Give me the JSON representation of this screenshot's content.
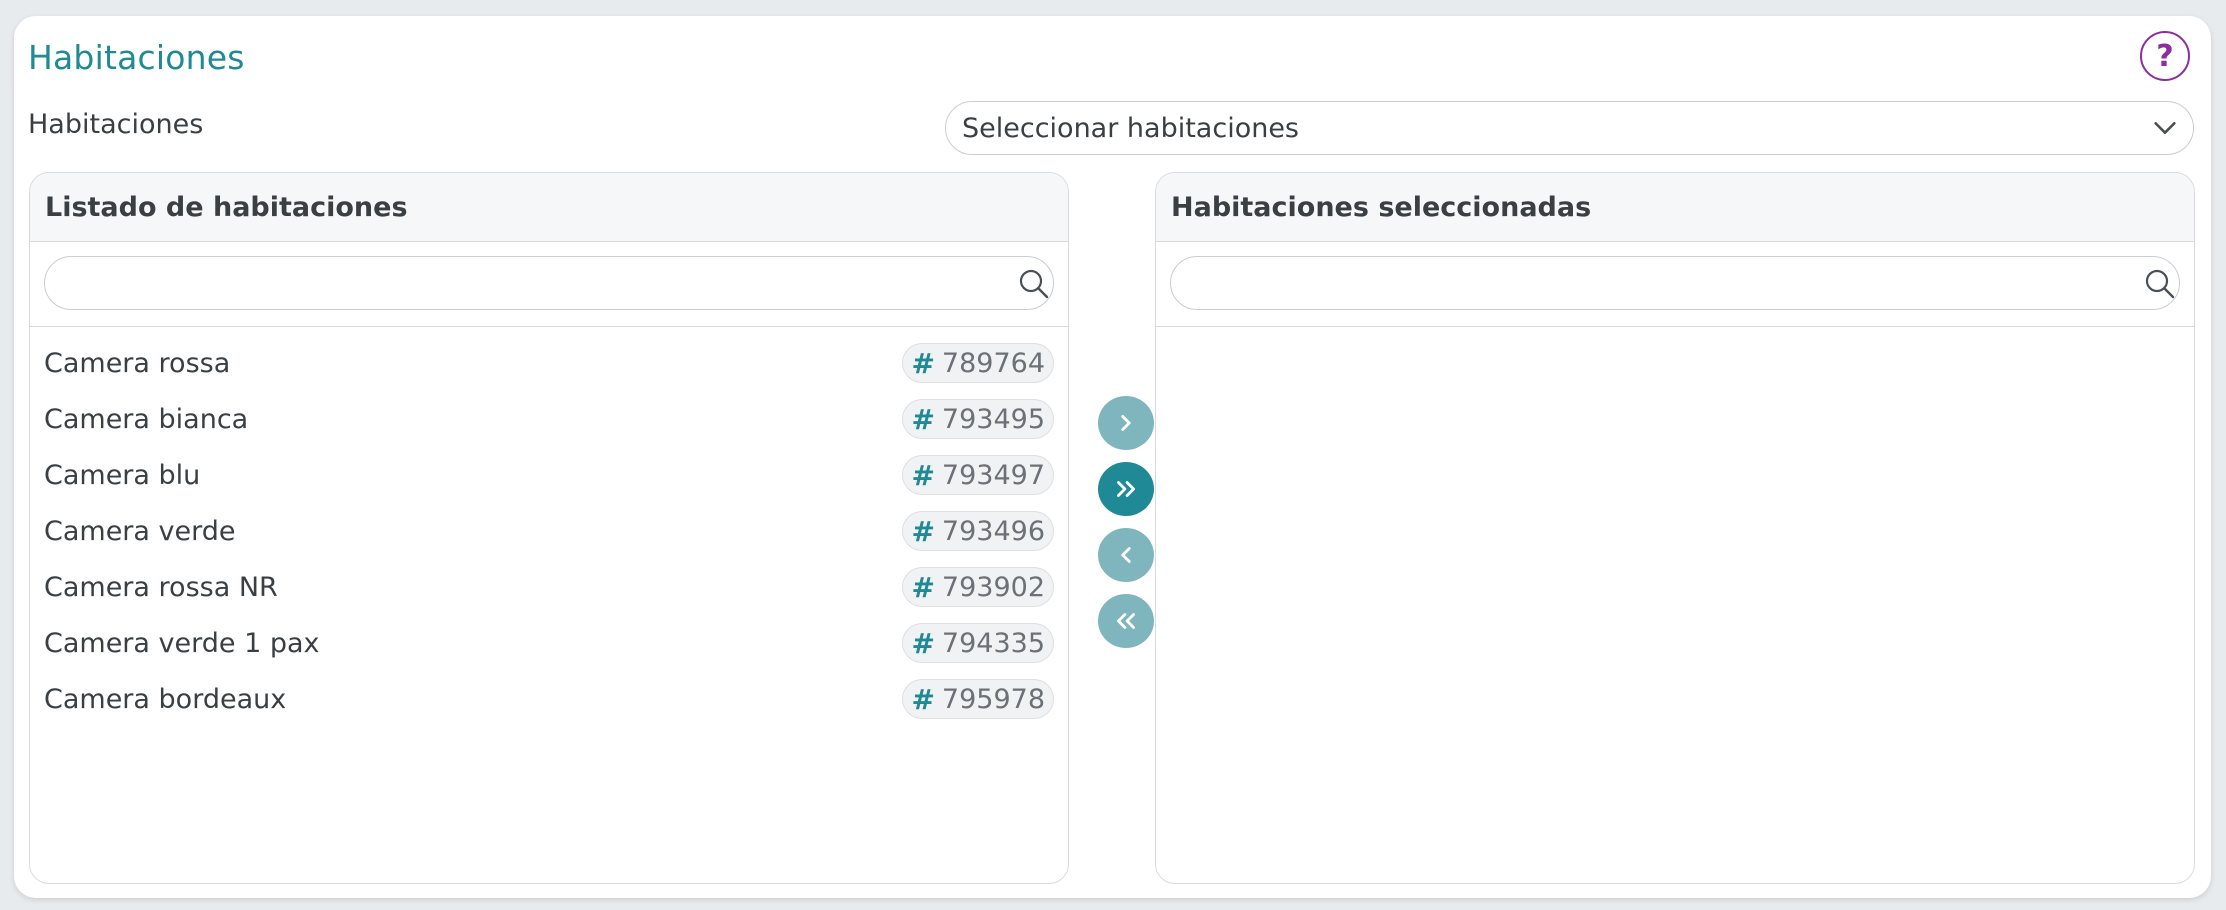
{
  "section": {
    "title": "Habitaciones",
    "help_label": "?"
  },
  "field": {
    "label": "Habitaciones",
    "select_value": "Seleccionar habitaciones"
  },
  "left_panel": {
    "title": "Listado de habitaciones",
    "search_value": "",
    "items": [
      {
        "name": "Camera rossa",
        "code": "789764"
      },
      {
        "name": "Camera bianca",
        "code": "793495"
      },
      {
        "name": "Camera blu",
        "code": "793497"
      },
      {
        "name": "Camera verde",
        "code": "793496"
      },
      {
        "name": "Camera rossa NR",
        "code": "793902"
      },
      {
        "name": "Camera verde 1 pax",
        "code": "794335"
      },
      {
        "name": "Camera bordeaux",
        "code": "795978"
      }
    ]
  },
  "right_panel": {
    "title": "Habitaciones seleccionadas",
    "search_value": "",
    "items": []
  },
  "transfer_buttons": [
    {
      "name": "move-selected-right",
      "icon": "chevron-right-icon",
      "state": "disabled"
    },
    {
      "name": "move-all-right",
      "icon": "double-chevron-right-icon",
      "state": "active"
    },
    {
      "name": "move-selected-left",
      "icon": "chevron-left-icon",
      "state": "disabled"
    },
    {
      "name": "move-all-left",
      "icon": "double-chevron-left-icon",
      "state": "disabled"
    }
  ],
  "colors": {
    "accent": "#1f8a96",
    "accent_muted": "#7fb6bd",
    "help": "#8e2ca0"
  }
}
